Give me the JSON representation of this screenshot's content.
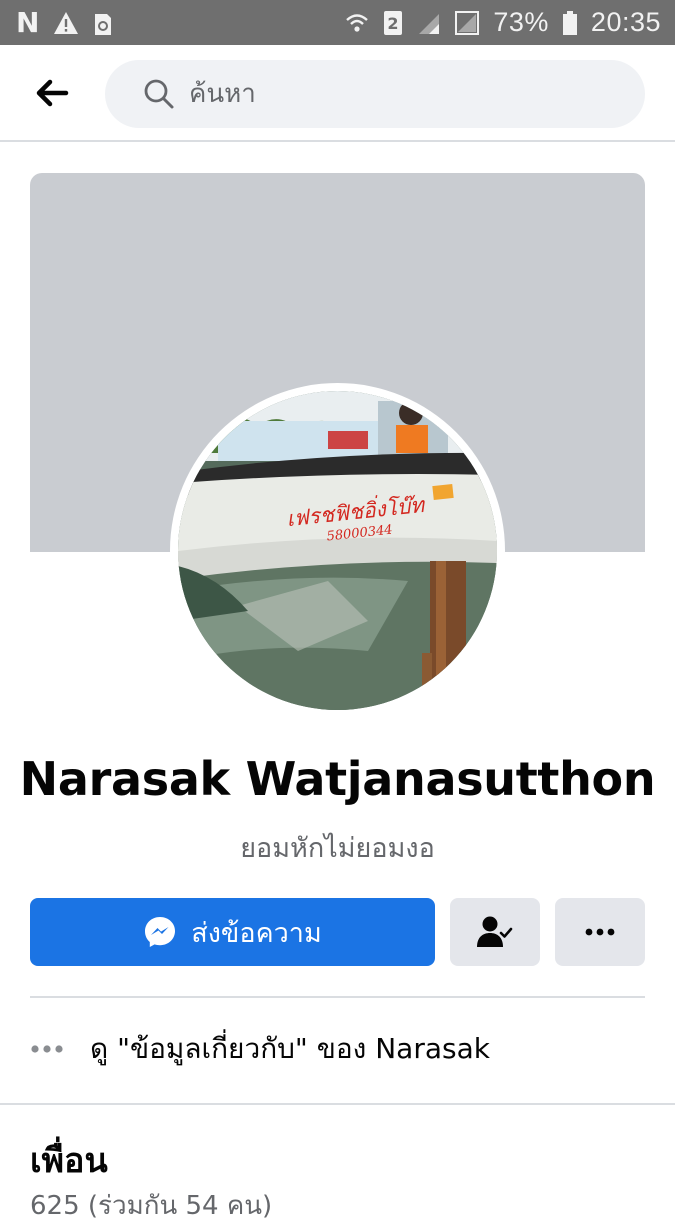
{
  "status_bar": {
    "left_icons": [
      "n-notification-icon",
      "warning-icon",
      "storage-icon"
    ],
    "right_icons": [
      "wifi-icon",
      "sim-2-icon",
      "signal-icon",
      "no-signal-icon",
      "battery-icon"
    ],
    "battery": "73%",
    "time": "20:35"
  },
  "search": {
    "placeholder": "ค้นหา"
  },
  "profile": {
    "name": "Narasak Watjanasutthon",
    "bio": "ยอมหักไม่ยอมงอ",
    "boat_text": "เฟรชฟิชอิ่งโบ๊ท",
    "boat_number": "58000344"
  },
  "actions": {
    "message_label": "ส่งข้อความ"
  },
  "about": {
    "label": "ดู \"ข้อมูลเกี่ยวกับ\" ของ Narasak"
  },
  "friends": {
    "title": "เพื่อน",
    "count": "625 (ร่วมกัน 54 คน)"
  },
  "colors": {
    "status_bar": "#6f6f6f",
    "primary": "#1b74e4",
    "cover": "#c9ccd1",
    "secondary_button": "#e4e6eb"
  }
}
